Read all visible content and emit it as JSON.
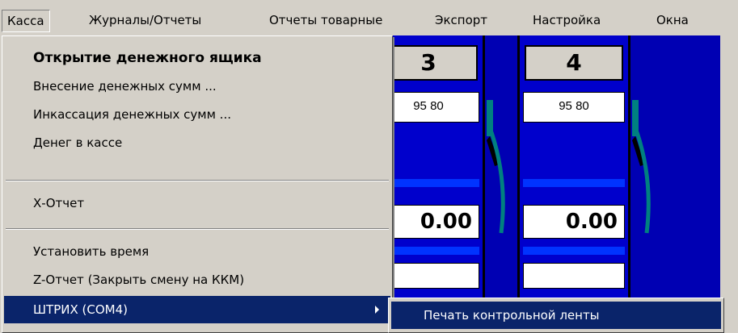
{
  "menubar": {
    "items": [
      "Касса",
      "Журналы/Отчеты",
      "Отчеты товарные",
      "Экспорт",
      "Настройка",
      "Окна"
    ]
  },
  "pumps": [
    {
      "number": "3",
      "fuel": "95 80",
      "amount": "0.00"
    },
    {
      "number": "4",
      "fuel": "95 80",
      "amount": "0.00"
    }
  ],
  "menu": {
    "items": [
      "Открытие денежного ящика",
      "Внесение денежных сумм ...",
      "Инкассация денежных сумм ...",
      "Денег в кассе",
      "Х-Отчет",
      "Установить время",
      "Z-Отчет (Закрыть смену на ККМ)",
      "ШТРИХ (COM4)"
    ]
  },
  "submenu": {
    "items": [
      "Печать контрольной ленты"
    ]
  },
  "colors": {
    "highlight": "#0a246a",
    "panel_blue": "#0000cc",
    "hose": "#008080"
  }
}
